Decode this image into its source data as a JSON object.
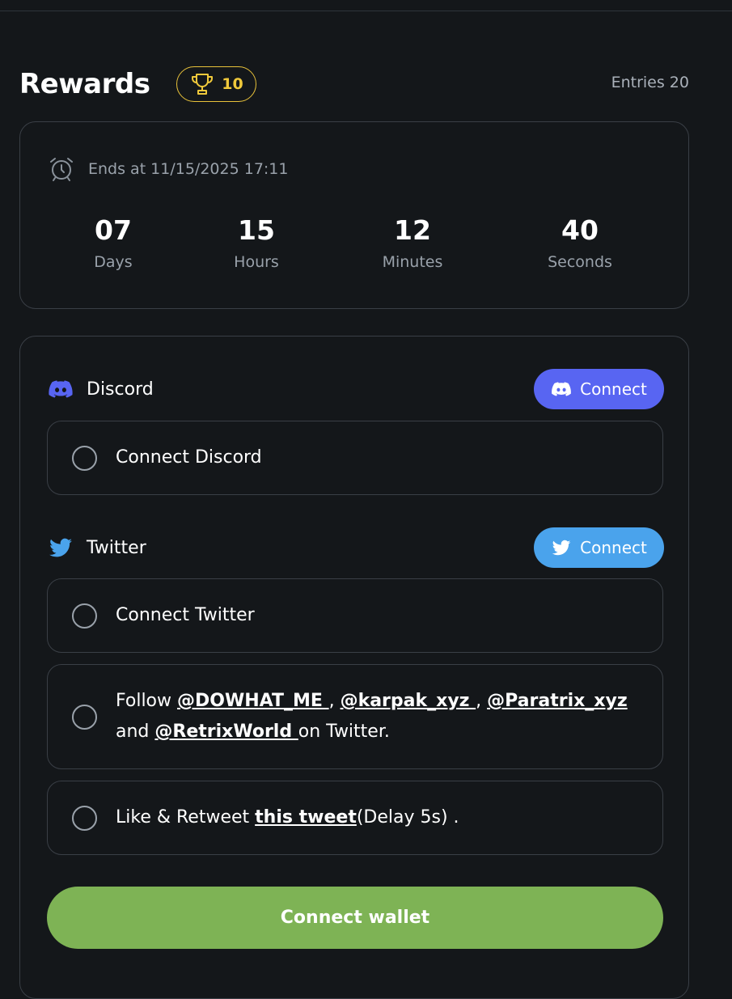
{
  "header": {
    "title": "Rewards",
    "trophy_count": "10",
    "entries": "Entries 20",
    "trophy_icon": "trophy-icon",
    "badge_color": "#f0c93b"
  },
  "countdown": {
    "ends_text": "Ends at 11/15/2025 17:11",
    "icon": "alarm-clock-icon",
    "units": [
      {
        "value": "07",
        "label": "Days"
      },
      {
        "value": "15",
        "label": "Hours"
      },
      {
        "value": "12",
        "label": "Minutes"
      },
      {
        "value": "40",
        "label": "Seconds"
      }
    ]
  },
  "discord": {
    "title": "Discord",
    "connect_label": "Connect",
    "color": "#5865f2",
    "icon": "discord-icon",
    "tasks": [
      {
        "text": "Connect Discord"
      }
    ]
  },
  "twitter": {
    "title": "Twitter",
    "connect_label": "Connect",
    "color": "#4aa3ec",
    "icon": "twitter-icon",
    "connect_task": "Connect Twitter",
    "follow_task": {
      "prefix": "Follow ",
      "link1": "@DOWHAT_ME ",
      "sep1": ", ",
      "link2": "@karpak_xyz ",
      "sep2": ", ",
      "link3": "@Paratrix_xyz ",
      "sep3": "and ",
      "link4": "@RetrixWorld ",
      "suffix": "on Twitter."
    },
    "like_task": {
      "prefix": "Like & Retweet ",
      "link": "this tweet",
      "suffix": "(Delay 5s) ."
    }
  },
  "wallet": {
    "label": "Connect wallet",
    "color": "#7eb355"
  }
}
